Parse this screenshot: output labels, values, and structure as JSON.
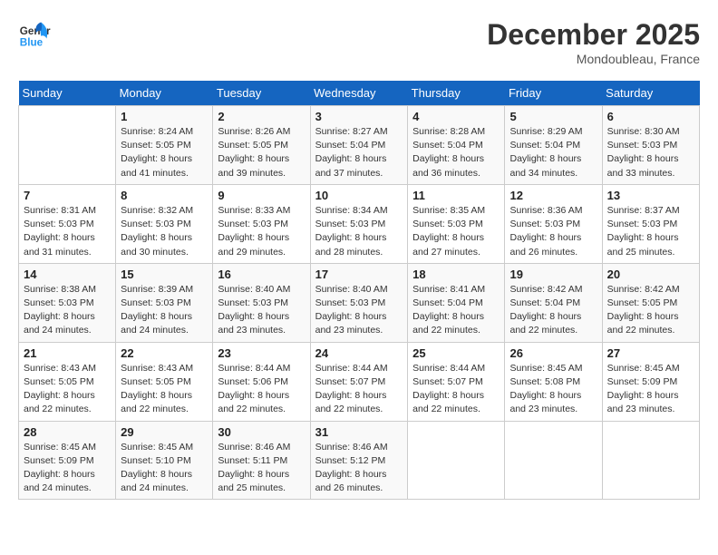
{
  "header": {
    "logo_line1": "General",
    "logo_line2": "Blue",
    "month": "December 2025",
    "location": "Mondoubleau, France"
  },
  "weekdays": [
    "Sunday",
    "Monday",
    "Tuesday",
    "Wednesday",
    "Thursday",
    "Friday",
    "Saturday"
  ],
  "weeks": [
    [
      {
        "day": "",
        "sunrise": "",
        "sunset": "",
        "daylight": ""
      },
      {
        "day": "1",
        "sunrise": "Sunrise: 8:24 AM",
        "sunset": "Sunset: 5:05 PM",
        "daylight": "Daylight: 8 hours and 41 minutes."
      },
      {
        "day": "2",
        "sunrise": "Sunrise: 8:26 AM",
        "sunset": "Sunset: 5:05 PM",
        "daylight": "Daylight: 8 hours and 39 minutes."
      },
      {
        "day": "3",
        "sunrise": "Sunrise: 8:27 AM",
        "sunset": "Sunset: 5:04 PM",
        "daylight": "Daylight: 8 hours and 37 minutes."
      },
      {
        "day": "4",
        "sunrise": "Sunrise: 8:28 AM",
        "sunset": "Sunset: 5:04 PM",
        "daylight": "Daylight: 8 hours and 36 minutes."
      },
      {
        "day": "5",
        "sunrise": "Sunrise: 8:29 AM",
        "sunset": "Sunset: 5:04 PM",
        "daylight": "Daylight: 8 hours and 34 minutes."
      },
      {
        "day": "6",
        "sunrise": "Sunrise: 8:30 AM",
        "sunset": "Sunset: 5:03 PM",
        "daylight": "Daylight: 8 hours and 33 minutes."
      }
    ],
    [
      {
        "day": "7",
        "sunrise": "Sunrise: 8:31 AM",
        "sunset": "Sunset: 5:03 PM",
        "daylight": "Daylight: 8 hours and 31 minutes."
      },
      {
        "day": "8",
        "sunrise": "Sunrise: 8:32 AM",
        "sunset": "Sunset: 5:03 PM",
        "daylight": "Daylight: 8 hours and 30 minutes."
      },
      {
        "day": "9",
        "sunrise": "Sunrise: 8:33 AM",
        "sunset": "Sunset: 5:03 PM",
        "daylight": "Daylight: 8 hours and 29 minutes."
      },
      {
        "day": "10",
        "sunrise": "Sunrise: 8:34 AM",
        "sunset": "Sunset: 5:03 PM",
        "daylight": "Daylight: 8 hours and 28 minutes."
      },
      {
        "day": "11",
        "sunrise": "Sunrise: 8:35 AM",
        "sunset": "Sunset: 5:03 PM",
        "daylight": "Daylight: 8 hours and 27 minutes."
      },
      {
        "day": "12",
        "sunrise": "Sunrise: 8:36 AM",
        "sunset": "Sunset: 5:03 PM",
        "daylight": "Daylight: 8 hours and 26 minutes."
      },
      {
        "day": "13",
        "sunrise": "Sunrise: 8:37 AM",
        "sunset": "Sunset: 5:03 PM",
        "daylight": "Daylight: 8 hours and 25 minutes."
      }
    ],
    [
      {
        "day": "14",
        "sunrise": "Sunrise: 8:38 AM",
        "sunset": "Sunset: 5:03 PM",
        "daylight": "Daylight: 8 hours and 24 minutes."
      },
      {
        "day": "15",
        "sunrise": "Sunrise: 8:39 AM",
        "sunset": "Sunset: 5:03 PM",
        "daylight": "Daylight: 8 hours and 24 minutes."
      },
      {
        "day": "16",
        "sunrise": "Sunrise: 8:40 AM",
        "sunset": "Sunset: 5:03 PM",
        "daylight": "Daylight: 8 hours and 23 minutes."
      },
      {
        "day": "17",
        "sunrise": "Sunrise: 8:40 AM",
        "sunset": "Sunset: 5:03 PM",
        "daylight": "Daylight: 8 hours and 23 minutes."
      },
      {
        "day": "18",
        "sunrise": "Sunrise: 8:41 AM",
        "sunset": "Sunset: 5:04 PM",
        "daylight": "Daylight: 8 hours and 22 minutes."
      },
      {
        "day": "19",
        "sunrise": "Sunrise: 8:42 AM",
        "sunset": "Sunset: 5:04 PM",
        "daylight": "Daylight: 8 hours and 22 minutes."
      },
      {
        "day": "20",
        "sunrise": "Sunrise: 8:42 AM",
        "sunset": "Sunset: 5:05 PM",
        "daylight": "Daylight: 8 hours and 22 minutes."
      }
    ],
    [
      {
        "day": "21",
        "sunrise": "Sunrise: 8:43 AM",
        "sunset": "Sunset: 5:05 PM",
        "daylight": "Daylight: 8 hours and 22 minutes."
      },
      {
        "day": "22",
        "sunrise": "Sunrise: 8:43 AM",
        "sunset": "Sunset: 5:05 PM",
        "daylight": "Daylight: 8 hours and 22 minutes."
      },
      {
        "day": "23",
        "sunrise": "Sunrise: 8:44 AM",
        "sunset": "Sunset: 5:06 PM",
        "daylight": "Daylight: 8 hours and 22 minutes."
      },
      {
        "day": "24",
        "sunrise": "Sunrise: 8:44 AM",
        "sunset": "Sunset: 5:07 PM",
        "daylight": "Daylight: 8 hours and 22 minutes."
      },
      {
        "day": "25",
        "sunrise": "Sunrise: 8:44 AM",
        "sunset": "Sunset: 5:07 PM",
        "daylight": "Daylight: 8 hours and 22 minutes."
      },
      {
        "day": "26",
        "sunrise": "Sunrise: 8:45 AM",
        "sunset": "Sunset: 5:08 PM",
        "daylight": "Daylight: 8 hours and 23 minutes."
      },
      {
        "day": "27",
        "sunrise": "Sunrise: 8:45 AM",
        "sunset": "Sunset: 5:09 PM",
        "daylight": "Daylight: 8 hours and 23 minutes."
      }
    ],
    [
      {
        "day": "28",
        "sunrise": "Sunrise: 8:45 AM",
        "sunset": "Sunset: 5:09 PM",
        "daylight": "Daylight: 8 hours and 24 minutes."
      },
      {
        "day": "29",
        "sunrise": "Sunrise: 8:45 AM",
        "sunset": "Sunset: 5:10 PM",
        "daylight": "Daylight: 8 hours and 24 minutes."
      },
      {
        "day": "30",
        "sunrise": "Sunrise: 8:46 AM",
        "sunset": "Sunset: 5:11 PM",
        "daylight": "Daylight: 8 hours and 25 minutes."
      },
      {
        "day": "31",
        "sunrise": "Sunrise: 8:46 AM",
        "sunset": "Sunset: 5:12 PM",
        "daylight": "Daylight: 8 hours and 26 minutes."
      },
      {
        "day": "",
        "sunrise": "",
        "sunset": "",
        "daylight": ""
      },
      {
        "day": "",
        "sunrise": "",
        "sunset": "",
        "daylight": ""
      },
      {
        "day": "",
        "sunrise": "",
        "sunset": "",
        "daylight": ""
      }
    ]
  ]
}
